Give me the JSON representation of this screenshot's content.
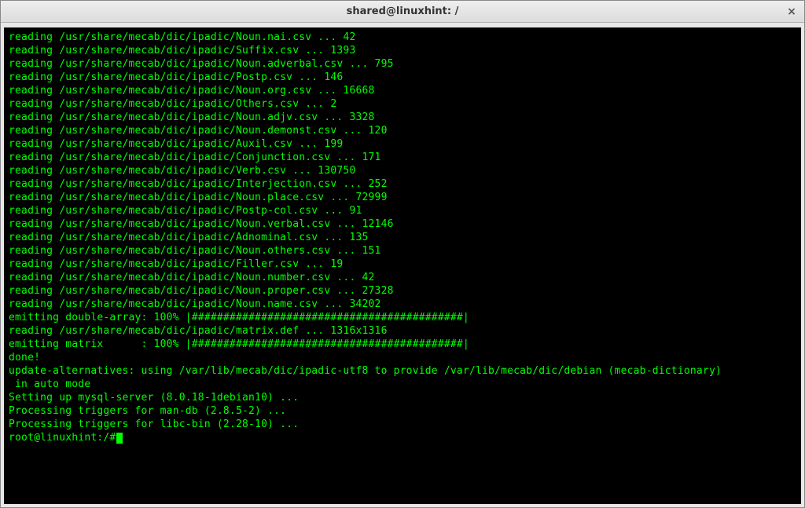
{
  "window": {
    "title": "shared@linuxhint: /",
    "close_label": "×"
  },
  "terminal": {
    "lines": [
      "reading /usr/share/mecab/dic/ipadic/Noun.nai.csv ... 42",
      "reading /usr/share/mecab/dic/ipadic/Suffix.csv ... 1393",
      "reading /usr/share/mecab/dic/ipadic/Noun.adverbal.csv ... 795",
      "reading /usr/share/mecab/dic/ipadic/Postp.csv ... 146",
      "reading /usr/share/mecab/dic/ipadic/Noun.org.csv ... 16668",
      "reading /usr/share/mecab/dic/ipadic/Others.csv ... 2",
      "reading /usr/share/mecab/dic/ipadic/Noun.adjv.csv ... 3328",
      "reading /usr/share/mecab/dic/ipadic/Noun.demonst.csv ... 120",
      "reading /usr/share/mecab/dic/ipadic/Auxil.csv ... 199",
      "reading /usr/share/mecab/dic/ipadic/Conjunction.csv ... 171",
      "reading /usr/share/mecab/dic/ipadic/Verb.csv ... 130750",
      "reading /usr/share/mecab/dic/ipadic/Interjection.csv ... 252",
      "reading /usr/share/mecab/dic/ipadic/Noun.place.csv ... 72999",
      "reading /usr/share/mecab/dic/ipadic/Postp-col.csv ... 91",
      "reading /usr/share/mecab/dic/ipadic/Noun.verbal.csv ... 12146",
      "reading /usr/share/mecab/dic/ipadic/Adnominal.csv ... 135",
      "reading /usr/share/mecab/dic/ipadic/Noun.others.csv ... 151",
      "reading /usr/share/mecab/dic/ipadic/Filler.csv ... 19",
      "reading /usr/share/mecab/dic/ipadic/Noun.number.csv ... 42",
      "reading /usr/share/mecab/dic/ipadic/Noun.proper.csv ... 27328",
      "reading /usr/share/mecab/dic/ipadic/Noun.name.csv ... 34202",
      "emitting double-array: 100% |###########################################| ",
      "reading /usr/share/mecab/dic/ipadic/matrix.def ... 1316x1316",
      "emitting matrix      : 100% |###########################################| ",
      "",
      "done!",
      "update-alternatives: using /var/lib/mecab/dic/ipadic-utf8 to provide /var/lib/mecab/dic/debian (mecab-dictionary)",
      " in auto mode",
      "Setting up mysql-server (8.0.18-1debian10) ...",
      "Processing triggers for man-db (2.8.5-2) ...",
      "Processing triggers for libc-bin (2.28-10) ..."
    ],
    "prompt": "root@linuxhint:/#"
  }
}
